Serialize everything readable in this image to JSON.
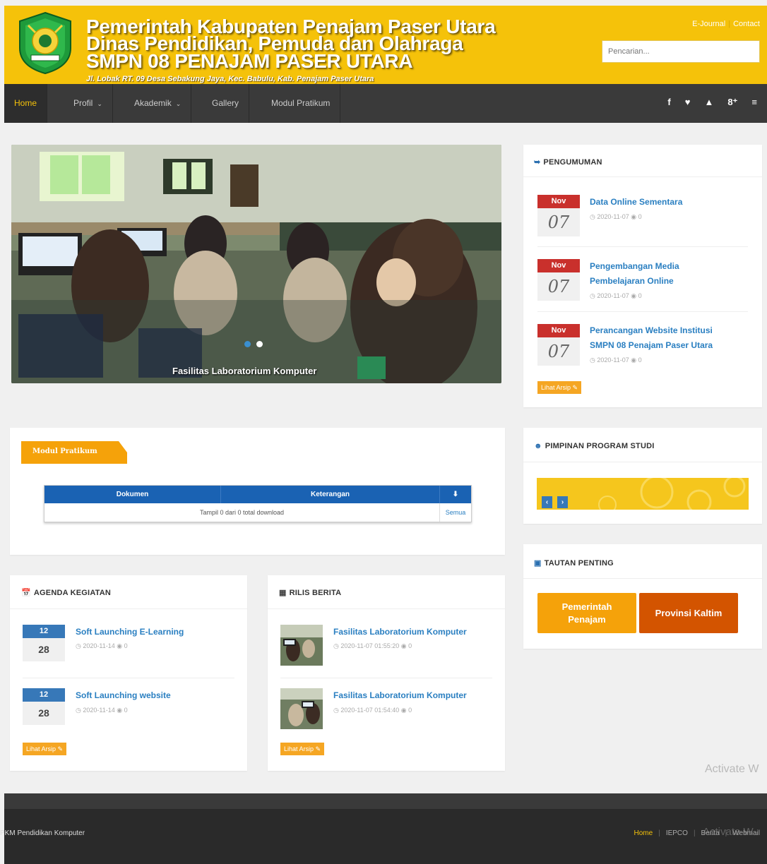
{
  "header": {
    "line1": "Pemerintah Kabupaten Penajam Paser Utara",
    "line2": "Dinas Pendidikan, Pemuda dan Olahraga",
    "line3": "SMPN 08 PENAJAM PASER UTARA",
    "address": "Jl. Lobak RT. 09 Desa Sebakung Jaya, Kec. Babulu, Kab. Penajam Paser Utara",
    "link_ejournal": "E-Journal",
    "link_contact": "Contact",
    "search_placeholder": "Pencarian..."
  },
  "nav": {
    "items": [
      {
        "label": "Home"
      },
      {
        "label": "Profil"
      },
      {
        "label": "Akademik"
      },
      {
        "label": "Gallery"
      },
      {
        "label": "Modul Pratikum"
      }
    ],
    "social": [
      "f",
      "♥",
      "▲",
      "8⁺",
      "≡"
    ]
  },
  "slider": {
    "caption": "Fasilitas Laboratorium Komputer"
  },
  "pengumuman": {
    "title": "PENGUMUMAN",
    "items": [
      {
        "month": "Nov",
        "day": "07",
        "title_l1": "Data Online Sementara",
        "title_l2": "",
        "meta": "◷ 2020-11-07 ◉ 0"
      },
      {
        "month": "Nov",
        "day": "07",
        "title_l1": "Pengembangan Media",
        "title_l2": "Pembelajaran Online",
        "meta": "◷ 2020-11-07 ◉ 0"
      },
      {
        "month": "Nov",
        "day": "07",
        "title_l1": "Perancangan Website Institusi",
        "title_l2": "SMPN 08 Penajam Paser Utara",
        "meta": "◷ 2020-11-07 ◉ 0"
      }
    ],
    "arsip": "Lihat Arsip ✎"
  },
  "modul": {
    "tab_label": "Modul Pratikum",
    "col_dokumen": "Dokumen",
    "col_keterangan": "Keterangan",
    "col_download": "⬇",
    "row_text": "Tampil 0 dari 0 total download",
    "row_link": "Semua"
  },
  "pimpinan": {
    "title": "PIMPINAN PROGRAM STUDI",
    "prev": "‹",
    "next": "›"
  },
  "tautan": {
    "title": "TAUTAN PENTING",
    "btn1_l1": "Pemerintah",
    "btn1_l2": "Penajam",
    "btn2": "Provinsi Kaltim"
  },
  "agenda": {
    "title": "AGENDA KEGIATAN",
    "items": [
      {
        "month": "12",
        "day": "28",
        "title": "Soft Launching E-Learning",
        "meta": "◷ 2020-11-14 ◉ 0"
      },
      {
        "month": "12",
        "day": "28",
        "title": "Soft Launching website",
        "meta": "◷ 2020-11-14 ◉ 0"
      }
    ],
    "arsip": "Lihat Arsip ✎"
  },
  "rilis": {
    "title": "RILIS BERITA",
    "items": [
      {
        "title": "Fasilitas Laboratorium Komputer",
        "meta": "◷ 2020-11-07 01:55:20 ◉ 0"
      },
      {
        "title": "Fasilitas Laboratorium Komputer",
        "meta": "◷ 2020-11-07 01:54:40 ◉ 0"
      }
    ],
    "arsip": "Lihat Arsip ✎"
  },
  "footer": {
    "copyright": "PKM Pendidikan Komputer",
    "links": [
      "Home",
      "IEPCO",
      "Berita",
      "Webmail"
    ]
  },
  "watermark": {
    "text1": "Activate W",
    "text2": "Activate W"
  },
  "colors": {
    "header_bg": "#f5c20a",
    "nav_bg": "#3a3a3a",
    "accent_blue": "#2a7fc1",
    "badge_red": "#c9302c",
    "badge_blue": "#3778b8",
    "orange": "#f5a623"
  }
}
